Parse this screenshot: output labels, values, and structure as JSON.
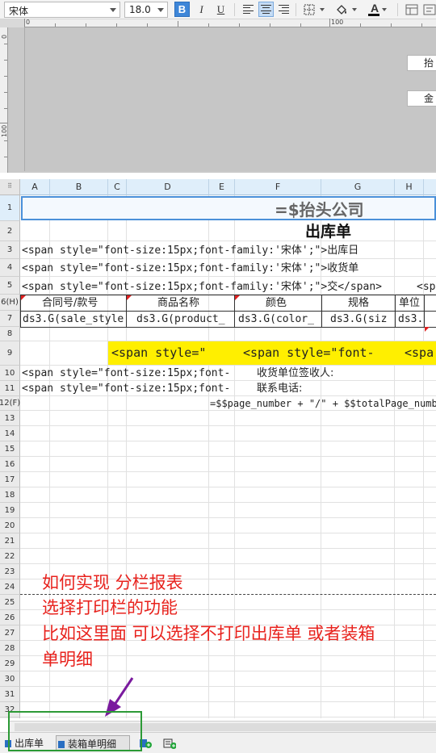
{
  "toolbar": {
    "font_name": "宋体",
    "font_size": "18.0",
    "bold_label": "B",
    "italic_label": "I",
    "underline_label": "U",
    "font_color_label": "A",
    "accent_color": "#3e86d8"
  },
  "ruler": {
    "h_ticks": [
      "0",
      "100"
    ],
    "v_ticks": [
      "0",
      "100"
    ]
  },
  "canvas": {
    "stub_1": "抬头",
    "stub_2": "金额"
  },
  "columns": [
    "A",
    "B",
    "C",
    "D",
    "E",
    "F",
    "G",
    "H"
  ],
  "rows": [
    "1",
    "2",
    "3",
    "4",
    "5",
    "6(H)",
    "7",
    "8",
    "9",
    "10",
    "11",
    "12(F)",
    "13",
    "14",
    "15",
    "16",
    "17",
    "18",
    "19",
    "20",
    "21",
    "22",
    "23",
    "24",
    "25",
    "26",
    "27",
    "28",
    "29",
    "30",
    "31",
    "32",
    "33"
  ],
  "cells": {
    "r1_title": "=$抬头公司",
    "r2_title": "出库单",
    "r3_text": "<span style=\"font-size:15px;font-family:'宋体';\">出库日",
    "r4_text": "<span style=\"font-size:15px;font-family:'宋体';\">收货单",
    "r5_text": "<span style=\"font-size:15px;font-family:'宋体';\">交</span>",
    "r5_right": "<sp",
    "r6_h1": "合同号/款号",
    "r6_h2": "商品名称",
    "r6_h3": "颜色",
    "r6_h4": "规格",
    "r6_h5": "单位",
    "r7_c1": "ds3.G(sale_style",
    "r7_c2": "ds3.G(product_",
    "r7_c3": "ds3.G(color_",
    "r7_c4": "ds3.G(siz",
    "r7_c5": "ds3.",
    "r9_c1": "<span style=\"",
    "r9_c2": "<span style=\"font-",
    "r9_c3": "<spa",
    "r10_left": "<span style=\"font-size:15px;font-",
    "r10_right": "收货单位签收人:",
    "r11_left": "<span style=\"font-size:15px;font-",
    "r11_right": "联系电话:",
    "r12_footer": "=$$page_number + \"/\" + $$totalPage_numbe"
  },
  "annotation": {
    "line1": "如何实现 分栏报表",
    "line2": "选择打印栏的功能",
    "line3": "比如这里面 可以选择不打印出库单 或者装箱",
    "line4": "单明细",
    "color": "#e8221d"
  },
  "tabs": [
    {
      "label": "出库单",
      "active": false
    },
    {
      "label": "装箱单明细",
      "active": true
    }
  ],
  "highlight_box_color": "#2c9a36",
  "arrow_color": "#7a1a9e"
}
